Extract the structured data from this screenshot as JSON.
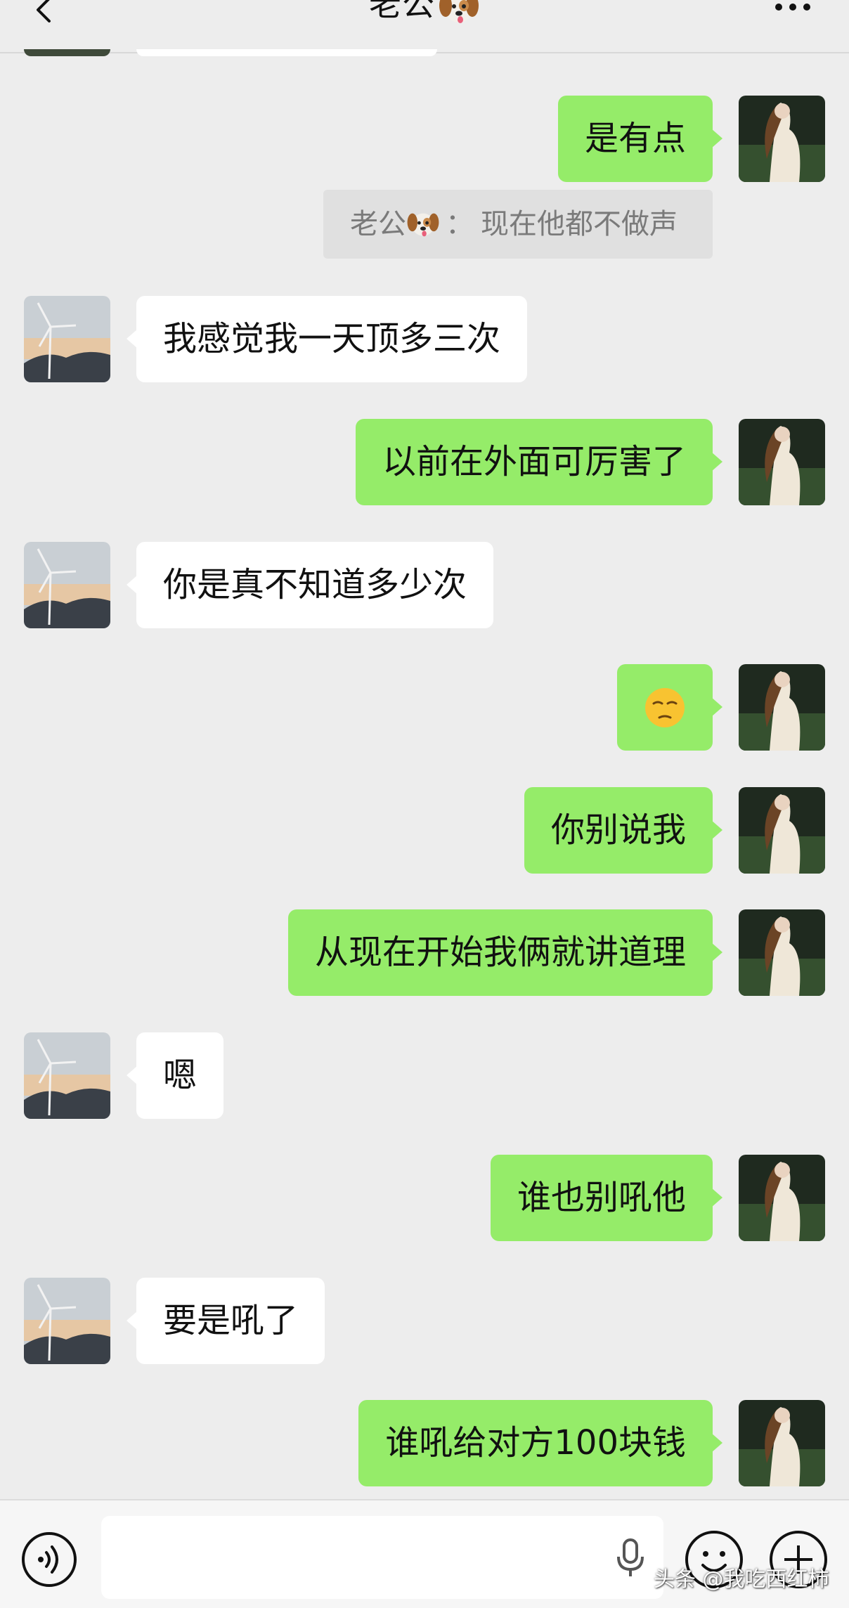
{
  "header": {
    "title": "老公",
    "title_emoji": "dog-face-icon"
  },
  "quote": {
    "sender": "老公",
    "separator": "：",
    "text": "现在他都不做声"
  },
  "messages": [
    {
      "side": "out",
      "text": "是有点"
    },
    {
      "side": "in",
      "text": "我感觉我一天顶多三次"
    },
    {
      "side": "out",
      "text": "以前在外面可厉害了"
    },
    {
      "side": "in",
      "text": "你是真不知道多少次"
    },
    {
      "side": "out",
      "text": "",
      "icon": "unamused-face-icon"
    },
    {
      "side": "out",
      "text": "你别说我"
    },
    {
      "side": "out",
      "text": "从现在开始我俩就讲道理"
    },
    {
      "side": "in",
      "text": "嗯"
    },
    {
      "side": "out",
      "text": "谁也别吼他"
    },
    {
      "side": "in",
      "text": "要是吼了"
    },
    {
      "side": "out",
      "text": "谁吼给对方100块钱"
    }
  ],
  "watermark": "头条 @我吃西红柿",
  "colors": {
    "outgoing_bubble": "#95ec69",
    "incoming_bubble": "#ffffff",
    "background": "#ededed"
  }
}
